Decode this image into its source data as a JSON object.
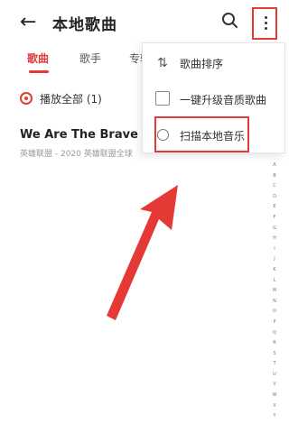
{
  "header": {
    "back_glyph": "←",
    "title": "本地歌曲",
    "search_glyph": "⌕"
  },
  "tabs": [
    "歌曲",
    "歌手",
    "专辑"
  ],
  "play_all": {
    "label": "播放全部 (1)"
  },
  "songs": [
    {
      "title": "We Are The Brave (英雄",
      "subtitle": "英雄联盟 - 2020 英雄联盟全球"
    }
  ],
  "menu": {
    "items": [
      {
        "label": "歌曲排序",
        "icon": "sort-icon",
        "glyph": "⇅"
      },
      {
        "label": "一键升级音质歌曲",
        "icon": "shield-icon"
      },
      {
        "label": "扫描本地音乐",
        "icon": "circle-icon"
      }
    ]
  },
  "alphabet_index": [
    "A",
    "B",
    "C",
    "D",
    "E",
    "F",
    "G",
    "H",
    "I",
    "J",
    "K",
    "L",
    "M",
    "N",
    "O",
    "P",
    "Q",
    "R",
    "S",
    "T",
    "U",
    "V",
    "W",
    "X",
    "Y",
    "Z",
    "#"
  ],
  "colors": {
    "accent": "#e53935",
    "annotation": "#e53935"
  }
}
